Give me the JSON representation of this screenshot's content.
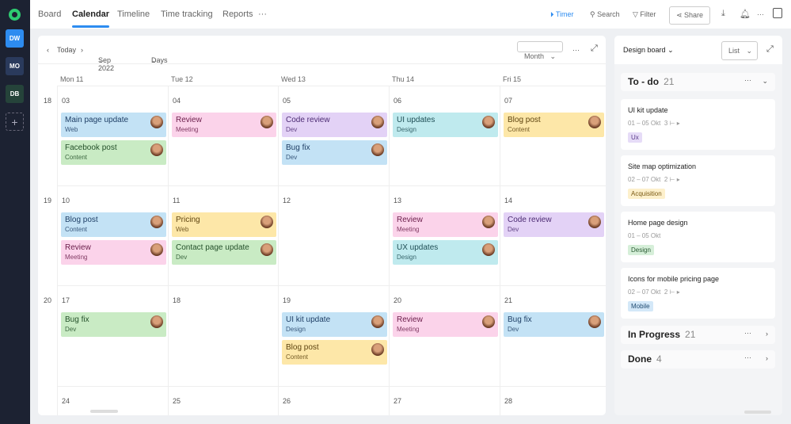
{
  "workspaces": [
    {
      "label": "DW",
      "color": "#2d8cf0"
    },
    {
      "label": "MO",
      "color": "#2a3a5c"
    },
    {
      "label": "DB",
      "color": "#25433a"
    }
  ],
  "tabs": [
    "Board",
    "Calendar",
    "Timeline",
    "Time tracking",
    "Reports"
  ],
  "active_tab": "Calendar",
  "toolbar": {
    "timer": "Timer",
    "search": "Search",
    "filter": "Filter",
    "share": "Share",
    "more": "···"
  },
  "calendar": {
    "today": "Today",
    "month": "Sep 2022",
    "view": "Days",
    "mode": "Month",
    "more": "···",
    "day_headers": [
      "Mon 11",
      "Tue 12",
      "Wed 13",
      "Thu 14",
      "Fri 15"
    ],
    "weeks": [
      {
        "num": "18",
        "days": [
          {
            "date": "03",
            "events": [
              {
                "title": "Main page update",
                "sub": "Web",
                "color": "blue"
              },
              {
                "title": "Facebook post",
                "sub": "Content",
                "color": "green"
              }
            ]
          },
          {
            "date": "04",
            "events": [
              {
                "title": "Review",
                "sub": "Meeting",
                "color": "pink"
              }
            ]
          },
          {
            "date": "05",
            "events": [
              {
                "title": "Code review",
                "sub": "Dev",
                "color": "purple"
              },
              {
                "title": "Bug fix",
                "sub": "Dev",
                "color": "blue"
              }
            ]
          },
          {
            "date": "06",
            "events": [
              {
                "title": "UI updates",
                "sub": "Design",
                "color": "cyan"
              }
            ]
          },
          {
            "date": "07",
            "events": [
              {
                "title": "Blog post",
                "sub": "Content",
                "color": "yellow"
              }
            ]
          }
        ]
      },
      {
        "num": "19",
        "days": [
          {
            "date": "10",
            "events": [
              {
                "title": "Blog post",
                "sub": "Content",
                "color": "blue"
              },
              {
                "title": "Review",
                "sub": "Meeting",
                "color": "pink"
              }
            ]
          },
          {
            "date": "11",
            "events": [
              {
                "title": "Pricing",
                "sub": "Web",
                "color": "yellow"
              },
              {
                "title": "Contact page update",
                "sub": "Dev",
                "color": "green"
              }
            ]
          },
          {
            "date": "12",
            "events": []
          },
          {
            "date": "13",
            "events": [
              {
                "title": "Review",
                "sub": "Meeting",
                "color": "pink"
              },
              {
                "title": "UX updates",
                "sub": "Design",
                "color": "cyan"
              }
            ]
          },
          {
            "date": "14",
            "events": [
              {
                "title": "Code review",
                "sub": "Dev",
                "color": "purple"
              }
            ]
          }
        ]
      },
      {
        "num": "20",
        "days": [
          {
            "date": "17",
            "events": [
              {
                "title": "Bug fix",
                "sub": "Dev",
                "color": "green"
              }
            ]
          },
          {
            "date": "18",
            "events": []
          },
          {
            "date": "19",
            "events": [
              {
                "title": "UI kit update",
                "sub": "Design",
                "color": "blue"
              },
              {
                "title": "Blog post",
                "sub": "Content",
                "color": "yellow"
              }
            ]
          },
          {
            "date": "20",
            "events": [
              {
                "title": "Review",
                "sub": "Meeting",
                "color": "pink"
              }
            ]
          },
          {
            "date": "21",
            "events": [
              {
                "title": "Bug fix",
                "sub": "Dev",
                "color": "blue"
              }
            ]
          }
        ]
      },
      {
        "num": "",
        "days": [
          {
            "date": "24",
            "events": []
          },
          {
            "date": "25",
            "events": []
          },
          {
            "date": "26",
            "events": []
          },
          {
            "date": "27",
            "events": []
          },
          {
            "date": "28",
            "events": []
          }
        ]
      }
    ]
  },
  "colors": {
    "blue": [
      "#c3e2f5",
      "#1f3f66"
    ],
    "green": [
      "#c9ebc4",
      "#24502a"
    ],
    "pink": [
      "#fbd3ea",
      "#6a1d4a"
    ],
    "purple": [
      "#e3d2f6",
      "#4b2a72"
    ],
    "cyan": [
      "#bfeaee",
      "#1f4e55"
    ],
    "yellow": [
      "#fde7a8",
      "#5e4410"
    ]
  },
  "board": {
    "title": "Design board",
    "view": "List",
    "groups": [
      {
        "name": "To - do",
        "count": "21"
      },
      {
        "name": "In Progress",
        "count": "21"
      },
      {
        "name": "Done",
        "count": "4"
      }
    ],
    "cards": [
      {
        "title": "UI kit update",
        "dates": "01 – 05 Okt",
        "subtasks": "3",
        "tag": "Ux",
        "tag_bg": "#e6dcf7",
        "tag_fg": "#5a3a8a"
      },
      {
        "title": "Site map optimization",
        "dates": "02 – 07 Okt",
        "subtasks": "2",
        "tag": "Acquisition",
        "tag_bg": "#fdf0cc",
        "tag_fg": "#7a5a14"
      },
      {
        "title": "Home page design",
        "dates": "01 – 05 Okt",
        "subtasks": "",
        "tag": "Design",
        "tag_bg": "#d6efd9",
        "tag_fg": "#2a5a33"
      },
      {
        "title": "Icons for mobile pricing page",
        "dates": "02 – 07 Okt",
        "subtasks": "2",
        "tag": "Mobile",
        "tag_bg": "#d4e8f8",
        "tag_fg": "#1f4a70"
      }
    ]
  }
}
